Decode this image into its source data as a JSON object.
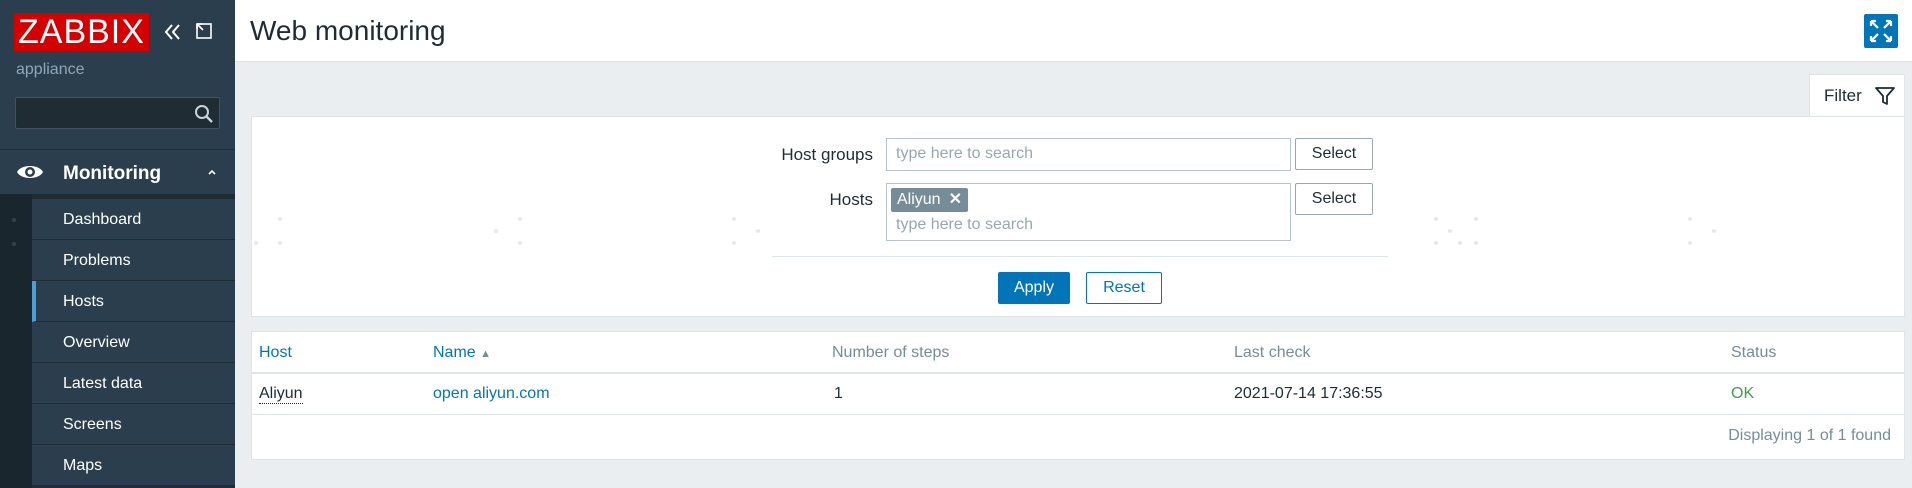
{
  "sidebar": {
    "logo": "ZABBIX",
    "server_name": "appliance",
    "search": {
      "placeholder": "",
      "value": ""
    },
    "section": {
      "label": "Monitoring"
    },
    "items": [
      {
        "label": "Dashboard"
      },
      {
        "label": "Problems"
      },
      {
        "label": "Hosts"
      },
      {
        "label": "Overview"
      },
      {
        "label": "Latest data"
      },
      {
        "label": "Screens"
      },
      {
        "label": "Maps"
      }
    ],
    "selected_item": "Hosts"
  },
  "header": {
    "title": "Web monitoring"
  },
  "filter": {
    "tab_label": "Filter",
    "host_groups_label": "Host groups",
    "host_groups_placeholder": "type here to search",
    "hosts_label": "Hosts",
    "hosts_tag": "Aliyun",
    "hosts_placeholder": "type here to search",
    "select_label": "Select",
    "apply_label": "Apply",
    "reset_label": "Reset"
  },
  "table": {
    "columns": {
      "host": "Host",
      "name": "Name",
      "steps": "Number of steps",
      "last_check": "Last check",
      "status": "Status"
    },
    "sort_indicator": "▲",
    "rows": [
      {
        "host": "Aliyun",
        "name": "open aliyun.com",
        "steps": "1",
        "last_check": "2021-07-14 17:36:55",
        "status": "OK"
      }
    ],
    "footer": "Displaying 1 of 1 found"
  },
  "colors": {
    "brand": "#d40000",
    "accent": "#0275b8",
    "sidebar_bg": "#2b3e4d",
    "status_ok": "#429e47"
  }
}
